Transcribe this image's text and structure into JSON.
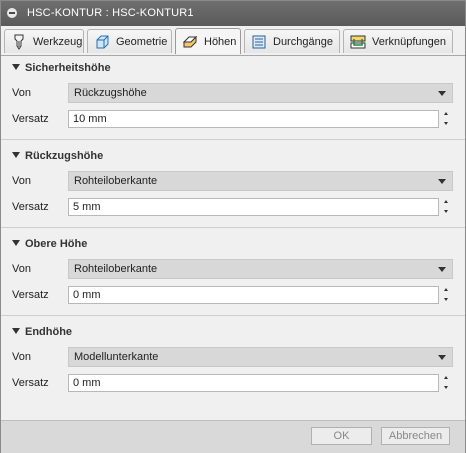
{
  "window": {
    "title": "HSC-KONTUR : HSC-KONTUR1"
  },
  "tabs": [
    {
      "label": "Werkzeug",
      "icon": "tool-icon"
    },
    {
      "label": "Geometrie",
      "icon": "geometry-icon"
    },
    {
      "label": "Höhen",
      "icon": "heights-icon",
      "active": true
    },
    {
      "label": "Durchgänge",
      "icon": "passes-icon"
    },
    {
      "label": "Verknüpfungen",
      "icon": "linking-icon"
    }
  ],
  "sections": [
    {
      "title": "Sicherheitshöhe",
      "von_label": "Von",
      "von_value": "Rückzugshöhe",
      "versatz_label": "Versatz",
      "versatz_value": "10 mm"
    },
    {
      "title": "Rückzugshöhe",
      "von_label": "Von",
      "von_value": "Rohteiloberkante",
      "versatz_label": "Versatz",
      "versatz_value": "5 mm"
    },
    {
      "title": "Obere Höhe",
      "von_label": "Von",
      "von_value": "Rohteiloberkante",
      "versatz_label": "Versatz",
      "versatz_value": "0 mm"
    },
    {
      "title": "Endhöhe",
      "von_label": "Von",
      "von_value": "Modellunterkante",
      "versatz_label": "Versatz",
      "versatz_value": "0 mm"
    }
  ],
  "footer": {
    "ok_label": "OK",
    "cancel_label": "Abbrechen"
  },
  "colors": {
    "titlebar": "#636363",
    "select_bg": "#d8d8d8",
    "footer_bg": "#d9d9d9"
  }
}
